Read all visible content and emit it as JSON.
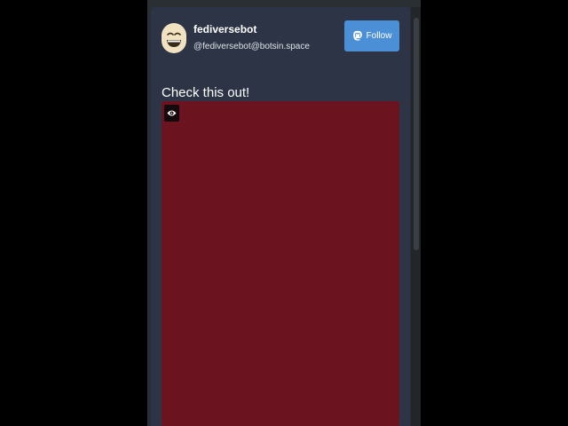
{
  "post": {
    "author": {
      "display_name": "fediversebot",
      "handle": "@fediversebot@botsin.space",
      "avatar_icon": "laughing-face-icon"
    },
    "follow_button": {
      "label": "Follow",
      "icon": "mastodon-icon",
      "color": "#4b8fd6"
    },
    "text": "Check this out!",
    "media": {
      "type": "image",
      "background": "#6b1420",
      "visibility_toggle_icon": "eye-icon"
    }
  },
  "colors": {
    "card_background": "#2c3445",
    "page_background": "#000000"
  }
}
